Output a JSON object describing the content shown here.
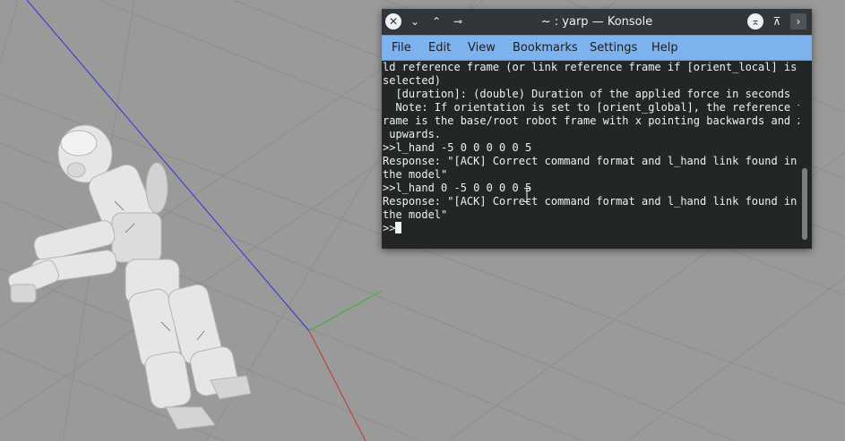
{
  "window": {
    "title": "~ : yarp — Konsole",
    "close_glyph": "✕",
    "minimize_glyph": "⌄",
    "maximize_glyph": "⌃",
    "pin_glyph": "⊸",
    "keep_above_glyph": "⌅",
    "shade_glyph": "⊼",
    "more_glyph": "›"
  },
  "menu": {
    "file": "File",
    "edit": "Edit",
    "view": "View",
    "bookmarks": "Bookmarks",
    "settings": "Settings",
    "help": "Help"
  },
  "terminal": {
    "lines": [
      "ld reference frame (or link reference frame if [orient_local] is",
      "selected)",
      "  [duration]: (double) Duration of the applied force in seconds",
      "  Note: If orientation is set to [orient_global], the reference f",
      "rame is the base/root robot frame with x pointing backwards and z",
      " upwards.",
      ">>l_hand -5 0 0 0 0 0 5",
      "Response: \"[ACK] Correct command format and l_hand link found in",
      "the model\"",
      ">>l_hand 0 -5 0 0 0 0 5",
      "Response: \"[ACK] Correct command format and l_hand link found in",
      "the model\""
    ],
    "prompt": ">>"
  },
  "colors": {
    "terminal_bg": "#232627",
    "terminal_fg": "#eff0f1",
    "menubar_bg": "#7eb2ef",
    "titlebar_bg": "#31363b",
    "viewport_bg": "#9a9a9a",
    "axis_x": "#c83232",
    "axis_y": "#32b432",
    "axis_z": "#3232dc"
  },
  "icons": {
    "close": "close-icon",
    "minimize": "chevron-down-icon",
    "maximize": "chevron-up-icon",
    "pin": "pin-icon",
    "keep_above": "keep-above-icon",
    "shade": "shade-icon",
    "more": "chevron-right-icon"
  }
}
